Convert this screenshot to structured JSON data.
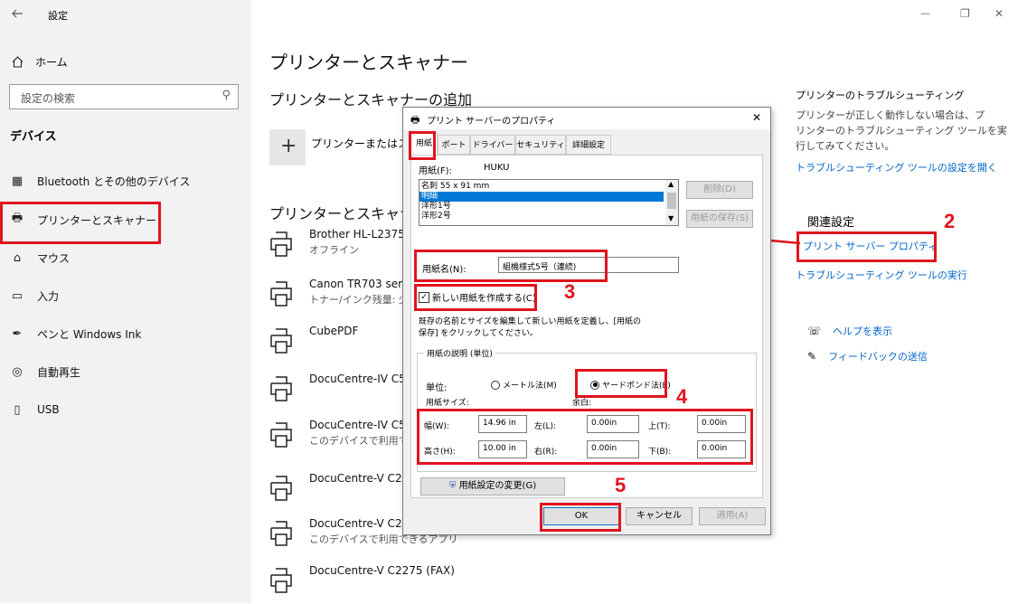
{
  "window": {
    "title": "設定",
    "back_icon": "back-arrow-icon",
    "controls": {
      "minimize": "—",
      "restore": "❐",
      "close": "✕"
    }
  },
  "sidebar": {
    "home_label": "ホーム",
    "search_placeholder": "設定の検索",
    "section_title": "デバイス",
    "items": [
      {
        "label": "Bluetooth とその他のデバイス",
        "icon": "bluetooth-device-icon"
      },
      {
        "label": "プリンターとスキャナー",
        "icon": "printer-icon"
      },
      {
        "label": "マウス",
        "icon": "mouse-icon"
      },
      {
        "label": "入力",
        "icon": "keyboard-icon"
      },
      {
        "label": "ペンと Windows Ink",
        "icon": "pen-icon"
      },
      {
        "label": "自動再生",
        "icon": "autoplay-icon"
      },
      {
        "label": "USB",
        "icon": "usb-icon"
      }
    ]
  },
  "main": {
    "page_title": "プリンターとスキャナー",
    "add_title": "プリンターとスキャナーの追加",
    "add_button_label": "プリンターまたはスキ",
    "list_title": "プリンターとスキャナー",
    "printers": [
      {
        "name": "Brother HL-L2375",
        "sub": "オフライン"
      },
      {
        "name": "Canon TR703 seri",
        "sub": "トナー/インク残量: 少"
      },
      {
        "name": "CubePDF",
        "sub": ""
      },
      {
        "name": "DocuCentre-IV C5",
        "sub": ""
      },
      {
        "name": "DocuCentre-IV C5",
        "sub": "このデバイスで利用で"
      },
      {
        "name": "DocuCentre-V C22",
        "sub": ""
      },
      {
        "name": "DocuCentre-V C22",
        "sub": "このデバイスで利用できるアプリ"
      },
      {
        "name": "DocuCentre-V C2275 (FAX)",
        "sub": ""
      }
    ]
  },
  "right": {
    "troubleshoot_title": "プリンターのトラブルシューティング",
    "troubleshoot_text": [
      "プリンターが正しく動作しない場合は、プ",
      "リンターのトラブルシューティング ツールを実",
      "行してみてください。"
    ],
    "troubleshoot_link": "トラブルシューティング ツールの設定を開く",
    "related_title": "関連設定",
    "print_server_link": "プリント サーバー プロパティ",
    "run_troubleshooter_link": "トラブルシューティング ツールの実行",
    "help_label": "ヘルプを表示",
    "feedback_label": "フィードバックの送信"
  },
  "dialog": {
    "title": "プリント サーバーのプロパティ",
    "close": "✕",
    "tabs": [
      "用紙",
      "ポート",
      "ドライバー",
      "セキュリティ",
      "詳細設定"
    ],
    "forms_on_label": "用紙(F):",
    "forms_on_value": "HUKU",
    "list_items": [
      "名刺 55 x 91 mm",
      "明細",
      "洋形1号",
      "洋形2号"
    ],
    "selected_index": 1,
    "delete_button": "削除(D)",
    "save_form_button": "用紙の保存(S)",
    "form_name_label": "用紙名(N):",
    "form_name_value": "組機様式5号（連続)",
    "create_new_label": "新しい用紙を作成する(C)",
    "create_new_checked": true,
    "help_text": [
      "既存の名前とサイズを編集して新しい用紙を定義し、[用紙の",
      "保存] をクリックしてください。"
    ],
    "description_group": "用紙の説明 (単位)",
    "units_label": "単位:",
    "metric_label": "メートル法(M)",
    "english_label": "ヤードポンド法(E)",
    "selected_unit": "english",
    "paper_size_label": "用紙サイズ:",
    "margins_label": "余白:",
    "width_label": "幅(W):",
    "width_value": "14.96 in",
    "height_label": "高さ(H):",
    "height_value": "10.00 in",
    "left_label": "左(L):",
    "left_value": "0.00in",
    "right_label": "右(R):",
    "right_value": "0.00in",
    "top_label": "上(T):",
    "top_value": "0.00in",
    "bottom_label": "下(B):",
    "bottom_value": "0.00in",
    "change_settings_button": "用紙設定の変更(G)",
    "ok_button": "OK",
    "cancel_button": "キャンセル",
    "apply_button": "適用(A)"
  },
  "annotations": {
    "step2": "2",
    "step3": "3",
    "step4": "4",
    "step5": "5"
  },
  "colors": {
    "highlight": "#e0141e",
    "link": "#0064c8",
    "selection": "#0078d7"
  }
}
